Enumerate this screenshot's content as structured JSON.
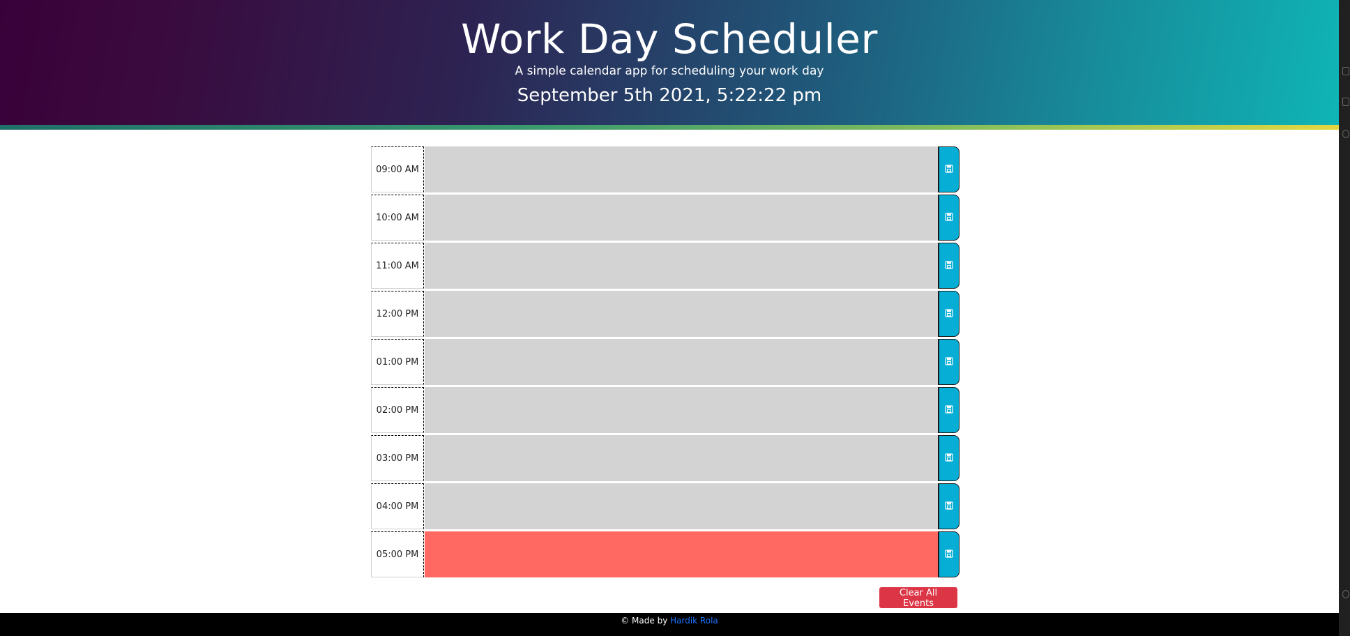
{
  "header": {
    "title": "Work Day Scheduler",
    "subtitle": "A simple calendar app for scheduling your work day",
    "datetime": "September 5th 2021, 5:22:22 pm"
  },
  "schedule": {
    "rows": [
      {
        "hour": "09:00 AM",
        "event": "",
        "status": "past"
      },
      {
        "hour": "10:00 AM",
        "event": "",
        "status": "past"
      },
      {
        "hour": "11:00 AM",
        "event": "",
        "status": "past"
      },
      {
        "hour": "12:00 PM",
        "event": "",
        "status": "past"
      },
      {
        "hour": "01:00 PM",
        "event": "",
        "status": "past"
      },
      {
        "hour": "02:00 PM",
        "event": "",
        "status": "past"
      },
      {
        "hour": "03:00 PM",
        "event": "",
        "status": "past"
      },
      {
        "hour": "04:00 PM",
        "event": "",
        "status": "past"
      },
      {
        "hour": "05:00 PM",
        "event": "",
        "status": "present"
      }
    ],
    "save_icon": "save-icon"
  },
  "actions": {
    "clear_label": "Clear All Events"
  },
  "footer": {
    "prefix": "© Made by ",
    "author": "Hardik Rola"
  },
  "colors": {
    "past": "#d3d3d3",
    "present": "#ff6961",
    "save": "#06aed5",
    "clear": "#dc3545"
  }
}
